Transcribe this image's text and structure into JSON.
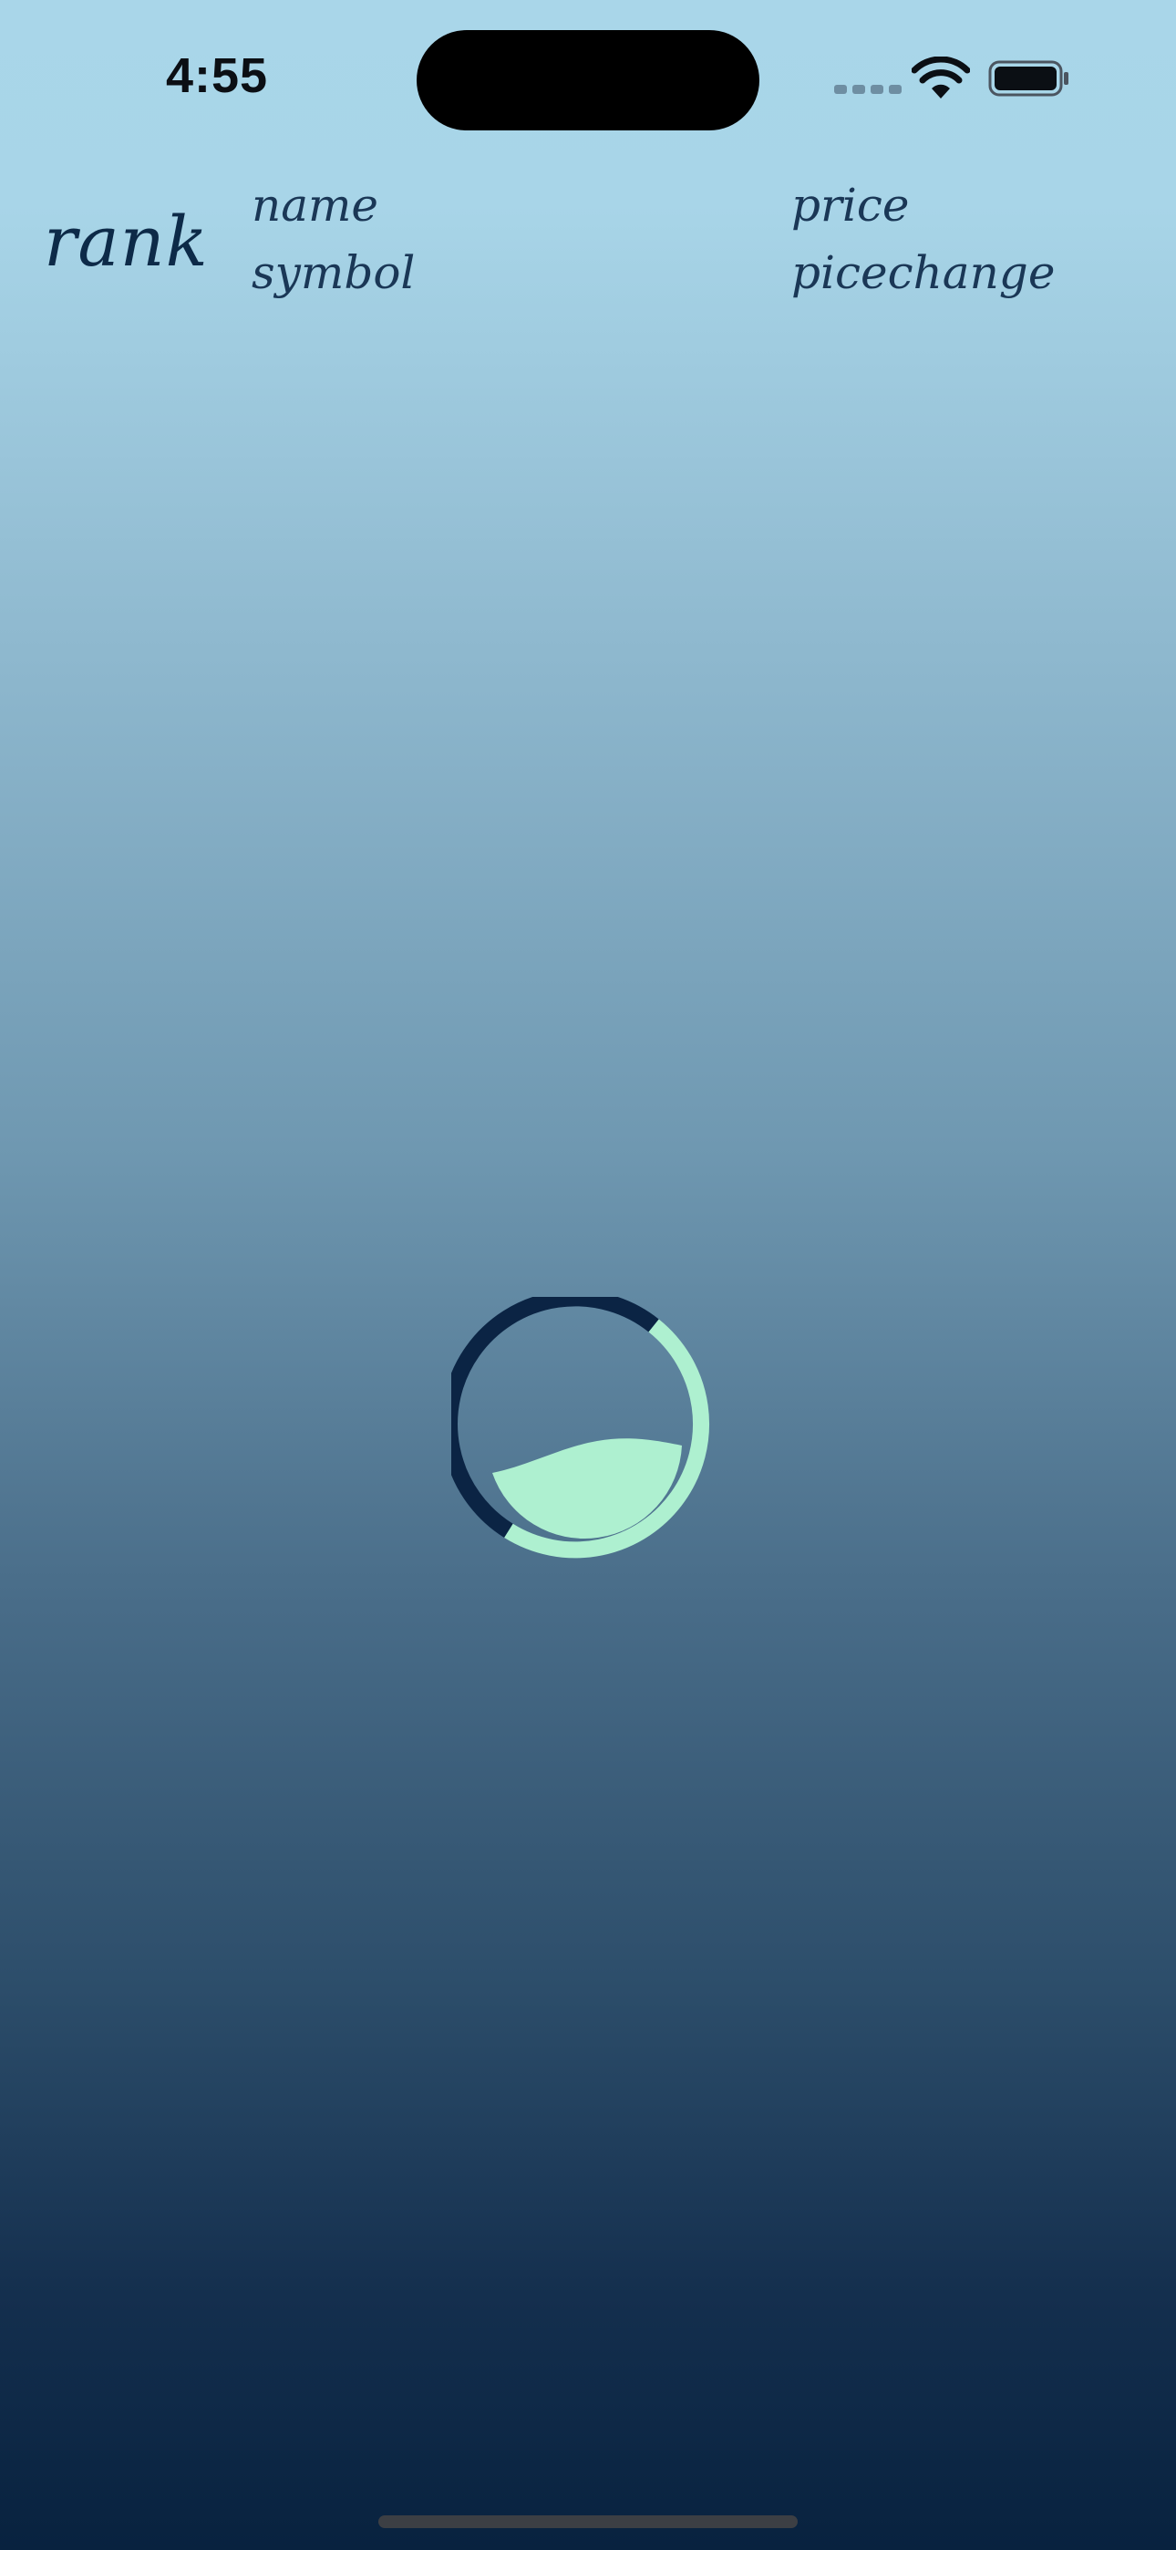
{
  "status_bar": {
    "time": "4:55",
    "icons": [
      "cellular-signal-icon",
      "wifi-icon",
      "battery-icon"
    ]
  },
  "header": {
    "rank": "rank",
    "name": "name",
    "symbol": "symbol",
    "price": "price",
    "price_change": "picechange"
  },
  "loader": {
    "icon": "loading-spinner-icon",
    "progress": 0.4,
    "colors": {
      "ring_dark": "#0b2444",
      "ring_light": "#aef0d0",
      "fill": "#aef0d0"
    }
  },
  "colors": {
    "background_top": "#a9d6e9",
    "background_bottom": "#08223f",
    "text": "#0f2a48"
  }
}
